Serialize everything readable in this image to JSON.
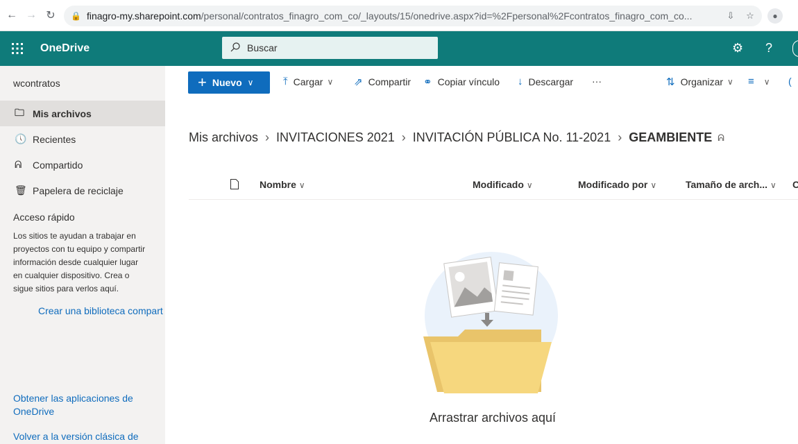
{
  "browser": {
    "url_host": "finagro-my.sharepoint.com",
    "url_path": "/personal/contratos_finagro_com_co/_layouts/15/onedrive.aspx?id=%2Fpersonal%2Fcontratos_finagro_com_co..."
  },
  "header": {
    "app_name": "OneDrive",
    "search_placeholder": "Buscar"
  },
  "sidebar": {
    "user": "wcontratos",
    "items": [
      {
        "label": "Mis archivos",
        "icon": "folder-icon"
      },
      {
        "label": "Recientes",
        "icon": "clock-icon"
      },
      {
        "label": "Compartido",
        "icon": "people-icon"
      },
      {
        "label": "Papelera de reciclaje",
        "icon": "trash-icon"
      }
    ],
    "quick_access_title": "Acceso rápido",
    "quick_access_desc": "Los sitios te ayudan a trabajar en proyectos con tu equipo y compartir información desde cualquier lugar en cualquier dispositivo. Crea o sigue sitios para verlos aquí.",
    "create_library": "Crear una biblioteca compart",
    "get_apps": "Obtener las aplicaciones de OneDrive",
    "classic": "Volver a la versión clásica de"
  },
  "toolbar": {
    "new": "Nuevo",
    "upload": "Cargar",
    "share": "Compartir",
    "copy_link": "Copiar vínculo",
    "download": "Descargar",
    "more": "···",
    "sort": "Organizar"
  },
  "breadcrumb": {
    "items": [
      "Mis archivos",
      "INVITACIONES 2021",
      "INVITACIÓN PÚBLICA No. 11-2021"
    ],
    "current": "GEAMBIENTE"
  },
  "columns": {
    "name": "Nombre",
    "modified": "Modificado",
    "modified_by": "Modificado por",
    "size": "Tamaño de arch...",
    "extra": "C"
  },
  "empty_state": {
    "text": "Arrastrar archivos aquí"
  }
}
